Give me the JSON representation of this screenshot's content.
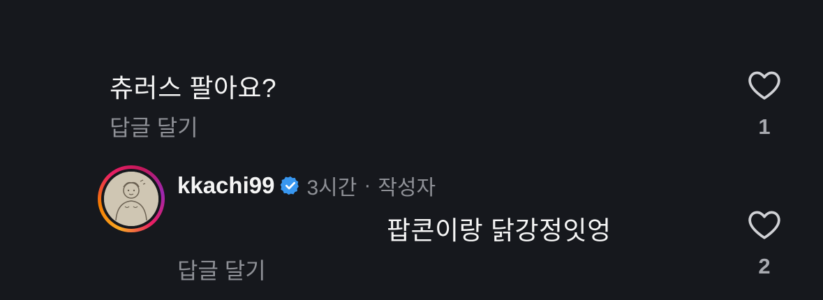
{
  "comments": [
    {
      "text": "츄러스 팔아요?",
      "reply_label": "답글 달기",
      "like_count": "1"
    },
    {
      "username": "kkachi99",
      "time": "3시간",
      "separator": "·",
      "author_tag": "작성자",
      "text": "팝콘이랑 닭강정잇엉",
      "reply_label": "답글 달기",
      "like_count": "2"
    }
  ],
  "icons": {
    "like": "heart-outline-icon",
    "verified": "verified-badge-icon"
  },
  "colors": {
    "background": "#16181d",
    "text": "#f5f5f5",
    "muted": "#8e9096",
    "verified": "#3897f0"
  }
}
